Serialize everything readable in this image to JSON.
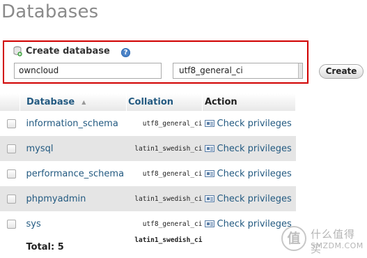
{
  "page": {
    "title": "Databases"
  },
  "create": {
    "heading": "Create database",
    "help_icon": "help-icon",
    "db_name_value": "owncloud",
    "collation_value": "utf8_general_ci",
    "button_label": "Create"
  },
  "table": {
    "headers": {
      "database": "Database",
      "collation": "Collation",
      "action": "Action"
    },
    "sort_icon": "▲",
    "rows": [
      {
        "name": "information_schema",
        "collation": "utf8_general_ci",
        "action": "Check privileges"
      },
      {
        "name": "mysql",
        "collation": "latin1_swedish_ci",
        "action": "Check privileges"
      },
      {
        "name": "performance_schema",
        "collation": "utf8_general_ci",
        "action": "Check privileges"
      },
      {
        "name": "phpmyadmin",
        "collation": "latin1_swedish_ci",
        "action": "Check privileges"
      },
      {
        "name": "sys",
        "collation": "utf8_general_ci",
        "action": "Check privileges"
      }
    ],
    "total": {
      "label": "Total: 5",
      "collation": "latin1_swedish_ci"
    }
  },
  "watermark": {
    "badge": "值",
    "line1": "什么值得买",
    "line2": "SMZDM.COM"
  },
  "colors": {
    "link": "#235a81",
    "highlight_border": "#d10000",
    "row_alt": "#e5e5e5"
  }
}
